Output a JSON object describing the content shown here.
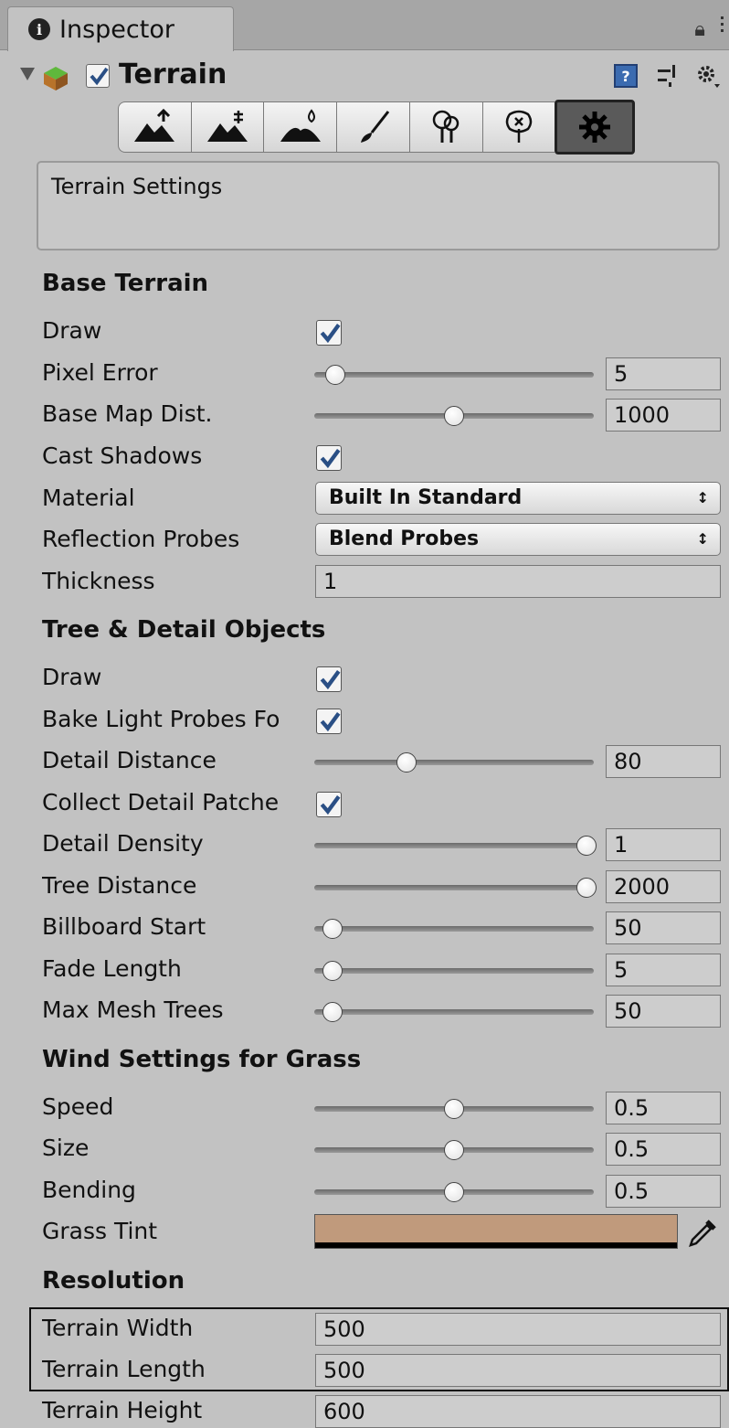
{
  "window": {
    "tab_title": "Inspector",
    "info_icon": "i"
  },
  "component": {
    "title": "Terrain",
    "enabled": true,
    "help_icon": "?"
  },
  "toolbar": {
    "tools": [
      "raise-lower-icon",
      "paint-height-icon",
      "smooth-height-icon",
      "paint-texture-icon",
      "place-trees-icon",
      "paint-details-icon",
      "settings-gear-icon"
    ],
    "active_index": 6
  },
  "description": "Terrain Settings",
  "sections": {
    "base_terrain": "Base Terrain",
    "tree_detail": "Tree & Detail Objects",
    "wind": "Wind Settings for Grass",
    "resolution": "Resolution"
  },
  "base": {
    "draw_label": "Draw",
    "draw": true,
    "pixel_error_label": "Pixel Error",
    "pixel_error": "5",
    "pixel_error_frac": 0.05,
    "base_map_label": "Base Map Dist.",
    "base_map": "1000",
    "base_map_frac": 0.5,
    "cast_shadows_label": "Cast Shadows",
    "cast_shadows": true,
    "material_label": "Material",
    "material": "Built In Standard",
    "reflection_label": "Reflection Probes",
    "reflection": "Blend Probes",
    "thickness_label": "Thickness",
    "thickness": "1"
  },
  "tree": {
    "draw_label": "Draw",
    "draw": true,
    "bake_label": "Bake Light Probes Fo",
    "bake": true,
    "detail_distance_label": "Detail Distance",
    "detail_distance": "80",
    "detail_distance_frac": 0.32,
    "collect_label": "Collect Detail Patche",
    "collect": true,
    "detail_density_label": "Detail Density",
    "detail_density": "1",
    "detail_density_frac": 1.0,
    "tree_distance_label": "Tree Distance",
    "tree_distance": "2000",
    "tree_distance_frac": 1.0,
    "billboard_label": "Billboard Start",
    "billboard": "50",
    "billboard_frac": 0.04,
    "fade_label": "Fade Length",
    "fade": "5",
    "fade_frac": 0.04,
    "max_mesh_label": "Max Mesh Trees",
    "max_mesh": "50",
    "max_mesh_frac": 0.04
  },
  "wind": {
    "speed_label": "Speed",
    "speed": "0.5",
    "speed_frac": 0.5,
    "size_label": "Size",
    "size": "0.5",
    "size_frac": 0.5,
    "bending_label": "Bending",
    "bending": "0.5",
    "bending_frac": 0.5,
    "tint_label": "Grass Tint",
    "tint_color": "#c09a7c"
  },
  "resolution": {
    "width_label": "Terrain Width",
    "width": "500",
    "length_label": "Terrain Length",
    "length": "500",
    "height_label": "Terrain Height",
    "height": "600"
  }
}
